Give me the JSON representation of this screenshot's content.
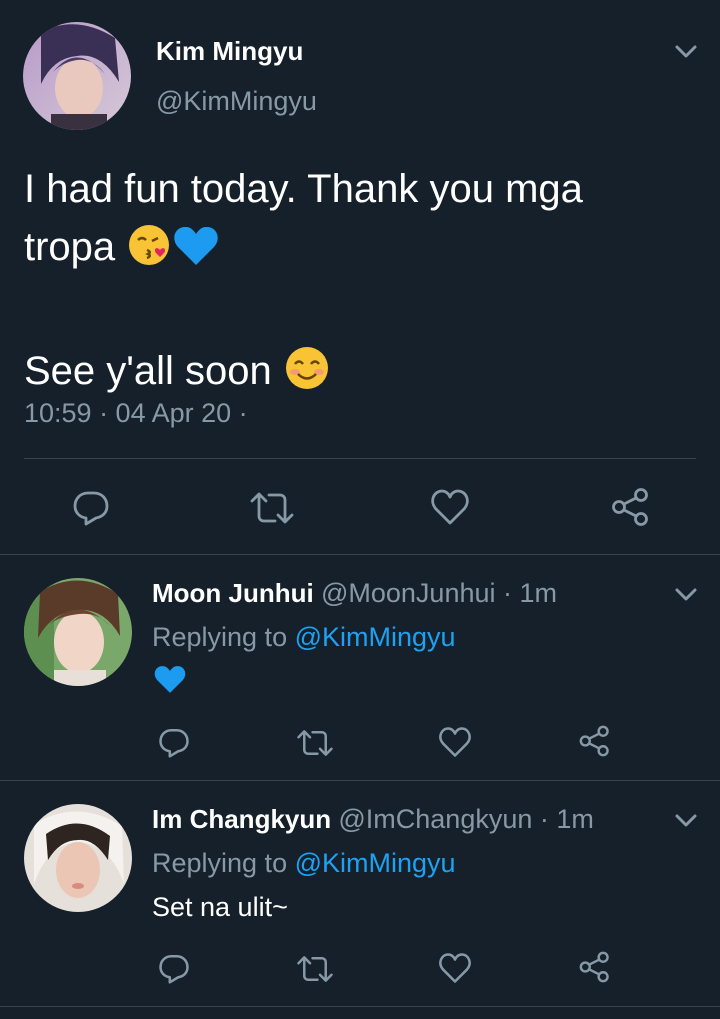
{
  "main_tweet": {
    "display_name": "Kim Mingyu",
    "handle": "@KimMingyu",
    "text_line1": "I had fun today. Thank you mga",
    "text_line2": "tropa",
    "text_line3": "See y'all soon",
    "emojis": [
      "kissing-heart-emoji",
      "blue-heart-emoji",
      "smiling-emoji"
    ],
    "timestamp": "10:59 · 04 Apr 20 ·",
    "actions": [
      "reply-icon",
      "retweet-icon",
      "like-icon",
      "share-icon"
    ]
  },
  "replies": [
    {
      "display_name": "Moon Junhui",
      "handle_time": "@MoonJunhui · 1m",
      "replying_prefix": "Replying to",
      "replying_handle": "@KimMingyu",
      "text": "",
      "emoji": "blue-heart-emoji"
    },
    {
      "display_name": "Im Changkyun",
      "handle_time": "@ImChangkyun · 1m",
      "replying_prefix": "Replying to",
      "replying_handle": "@KimMingyu",
      "text": "Set na ulit~"
    }
  ],
  "colors": {
    "background": "#15202b",
    "muted": "#8899a6",
    "link": "#1da1f2",
    "divider": "#38444d"
  }
}
